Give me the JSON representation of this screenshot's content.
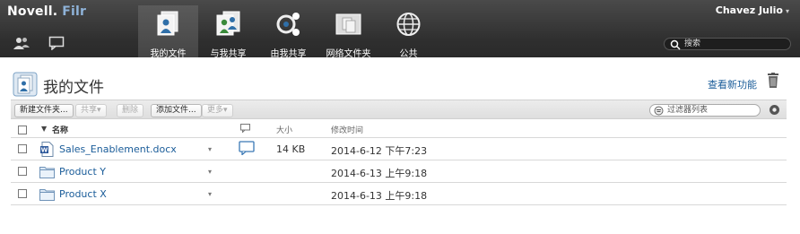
{
  "brand": {
    "name": "Novell.",
    "product": "Filr"
  },
  "user": {
    "name": "Chavez Julio",
    "caret": "▾"
  },
  "nav": [
    {
      "label": "我的文件",
      "icon": "my-files-icon",
      "active": true
    },
    {
      "label": "与我共享",
      "icon": "shared-with-me-icon",
      "active": false
    },
    {
      "label": "由我共享",
      "icon": "shared-by-me-icon",
      "active": false
    },
    {
      "label": "网络文件夹",
      "icon": "net-folders-icon",
      "active": false
    },
    {
      "label": "公共",
      "icon": "public-globe-icon",
      "active": false
    }
  ],
  "search": {
    "placeholder": "搜索"
  },
  "page": {
    "title": "我的文件",
    "whats_new": "查看新功能"
  },
  "toolbar": {
    "new_folder": "新建文件夹...",
    "share": "共享▾",
    "delete": "删除",
    "add_files": "添加文件...",
    "more": "更多▾",
    "filter_placeholder": "过滤器列表"
  },
  "table": {
    "headers": {
      "sort_arrow": "▼",
      "name": "名称",
      "size": "大小",
      "modified": "修改时间"
    },
    "rows": [
      {
        "name": "Sales_Enablement.docx",
        "type": "docx",
        "caret": "▾",
        "has_comment": true,
        "size": "14 KB",
        "modified": "2014-6-12 下午7:23"
      },
      {
        "name": "Product Y",
        "type": "folder",
        "caret": "▾",
        "has_comment": false,
        "size": "",
        "modified": "2014-6-13 上午9:18"
      },
      {
        "name": "Product X",
        "type": "folder",
        "caret": "▾",
        "has_comment": false,
        "size": "",
        "modified": "2014-6-13 上午9:18"
      }
    ]
  },
  "colors": {
    "topbar": "#2f2f2f",
    "link": "#1a5c99",
    "brand_accent": "#8fb3d9"
  }
}
